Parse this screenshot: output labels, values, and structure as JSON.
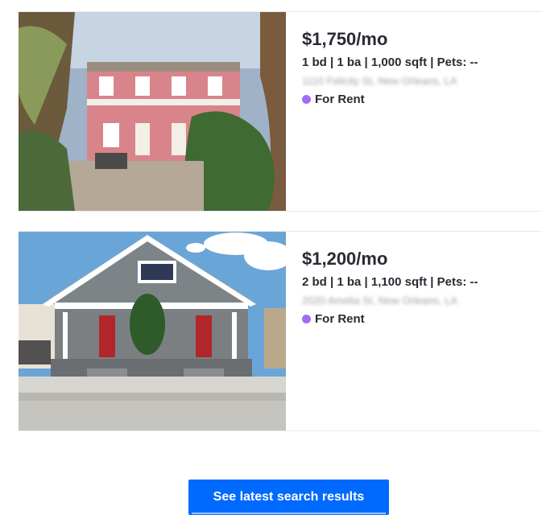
{
  "listings": [
    {
      "price": "$1,750/mo",
      "details": "1 bd | 1 ba | 1,000 sqft | Pets: --",
      "address": "1110 Felicity St, New Orleans, LA",
      "status": "For Rent",
      "status_color": "#a36cf7"
    },
    {
      "price": "$1,200/mo",
      "details": "2 bd | 1 ba | 1,100 sqft | Pets: --",
      "address": "2020 Amelia St, New Orleans, LA",
      "status": "For Rent",
      "status_color": "#a36cf7"
    }
  ],
  "cta": {
    "label": "See latest search results",
    "color": "#006aff"
  }
}
